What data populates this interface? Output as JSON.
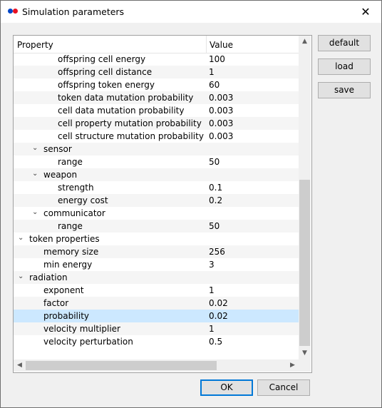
{
  "window": {
    "title": "Simulation parameters"
  },
  "table": {
    "headers": {
      "property": "Property",
      "value": "Value"
    },
    "rows": [
      {
        "name": "offspring cell energy",
        "value": "100",
        "level": 3,
        "expander": "",
        "selected": false
      },
      {
        "name": "offspring cell distance",
        "value": "1",
        "level": 3,
        "expander": "",
        "selected": false
      },
      {
        "name": "offspring token energy",
        "value": "60",
        "level": 3,
        "expander": "",
        "selected": false
      },
      {
        "name": "token data mutation probability",
        "value": "0.003",
        "level": 3,
        "expander": "",
        "selected": false
      },
      {
        "name": "cell data mutation probability",
        "value": "0.003",
        "level": 3,
        "expander": "",
        "selected": false
      },
      {
        "name": "cell property mutation probability",
        "value": "0.003",
        "level": 3,
        "expander": "",
        "selected": false
      },
      {
        "name": "cell structure mutation probability",
        "value": "0.003",
        "level": 3,
        "expander": "",
        "selected": false
      },
      {
        "name": "sensor",
        "value": "",
        "level": 2,
        "expander": "⌄",
        "selected": false
      },
      {
        "name": "range",
        "value": "50",
        "level": 3,
        "expander": "",
        "selected": false
      },
      {
        "name": "weapon",
        "value": "",
        "level": 2,
        "expander": "⌄",
        "selected": false
      },
      {
        "name": "strength",
        "value": "0.1",
        "level": 3,
        "expander": "",
        "selected": false
      },
      {
        "name": "energy cost",
        "value": "0.2",
        "level": 3,
        "expander": "",
        "selected": false
      },
      {
        "name": "communicator",
        "value": "",
        "level": 2,
        "expander": "⌄",
        "selected": false
      },
      {
        "name": "range",
        "value": "50",
        "level": 3,
        "expander": "",
        "selected": false
      },
      {
        "name": "token properties",
        "value": "",
        "level": 1,
        "expander": "⌄",
        "selected": false
      },
      {
        "name": "memory size",
        "value": "256",
        "level": 2,
        "expander": "",
        "selected": false
      },
      {
        "name": "min energy",
        "value": "3",
        "level": 2,
        "expander": "",
        "selected": false
      },
      {
        "name": "radiation",
        "value": "",
        "level": 1,
        "expander": "⌄",
        "selected": false
      },
      {
        "name": "exponent",
        "value": "1",
        "level": 2,
        "expander": "",
        "selected": false
      },
      {
        "name": "factor",
        "value": "0.02",
        "level": 2,
        "expander": "",
        "selected": false
      },
      {
        "name": "probability",
        "value": "0.02",
        "level": 2,
        "expander": "",
        "selected": true
      },
      {
        "name": "velocity multiplier",
        "value": "1",
        "level": 2,
        "expander": "",
        "selected": false
      },
      {
        "name": "velocity perturbation",
        "value": "0.5",
        "level": 2,
        "expander": "",
        "selected": false
      }
    ]
  },
  "side_buttons": {
    "default": "default",
    "load": "load",
    "save": "save"
  },
  "footer_buttons": {
    "ok": "OK",
    "cancel": "Cancel"
  },
  "colors": {
    "accent": "#0078d7",
    "selection": "#cce8ff",
    "logo_red": "#e81123",
    "logo_blue": "#0046c8"
  },
  "icons": {
    "app": "app-logo-icon",
    "close": "close-icon",
    "expander": "chevron-down-icon"
  }
}
